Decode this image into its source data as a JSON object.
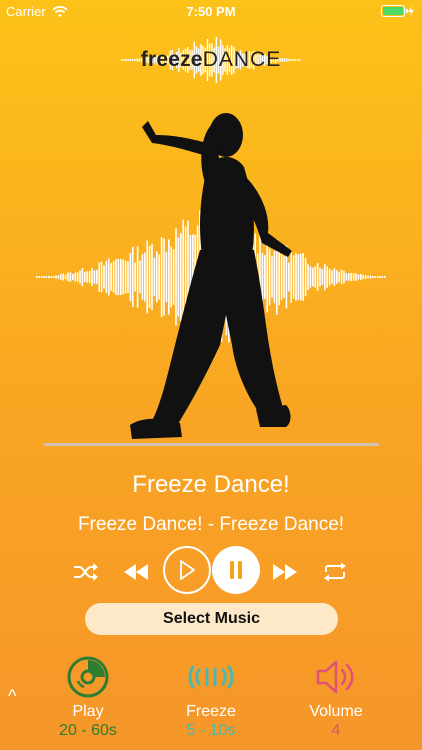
{
  "status": {
    "carrier": "Carrier",
    "time": "7:50 PM"
  },
  "logo": {
    "bold": "freeze",
    "light": "DANCE"
  },
  "track": {
    "title": "Freeze Dance!",
    "subtitle": "Freeze Dance! - Freeze Dance!"
  },
  "buttons": {
    "select_music": "Select Music"
  },
  "tabs": [
    {
      "label": "Play",
      "value": "20 - 60s",
      "color": "#2e7d32",
      "icon": "disc-play-icon"
    },
    {
      "label": "Freeze",
      "value": "5 - 10s",
      "color": "#47b9b0",
      "icon": "vibration-icon"
    },
    {
      "label": "Volume",
      "value": "4",
      "color": "#e0507b",
      "icon": "speaker-icon"
    }
  ],
  "caret": "^",
  "colors": {
    "bg_top": "#fcc218",
    "bg_bottom": "#f6962a",
    "button_bg": "#fde8c8"
  }
}
